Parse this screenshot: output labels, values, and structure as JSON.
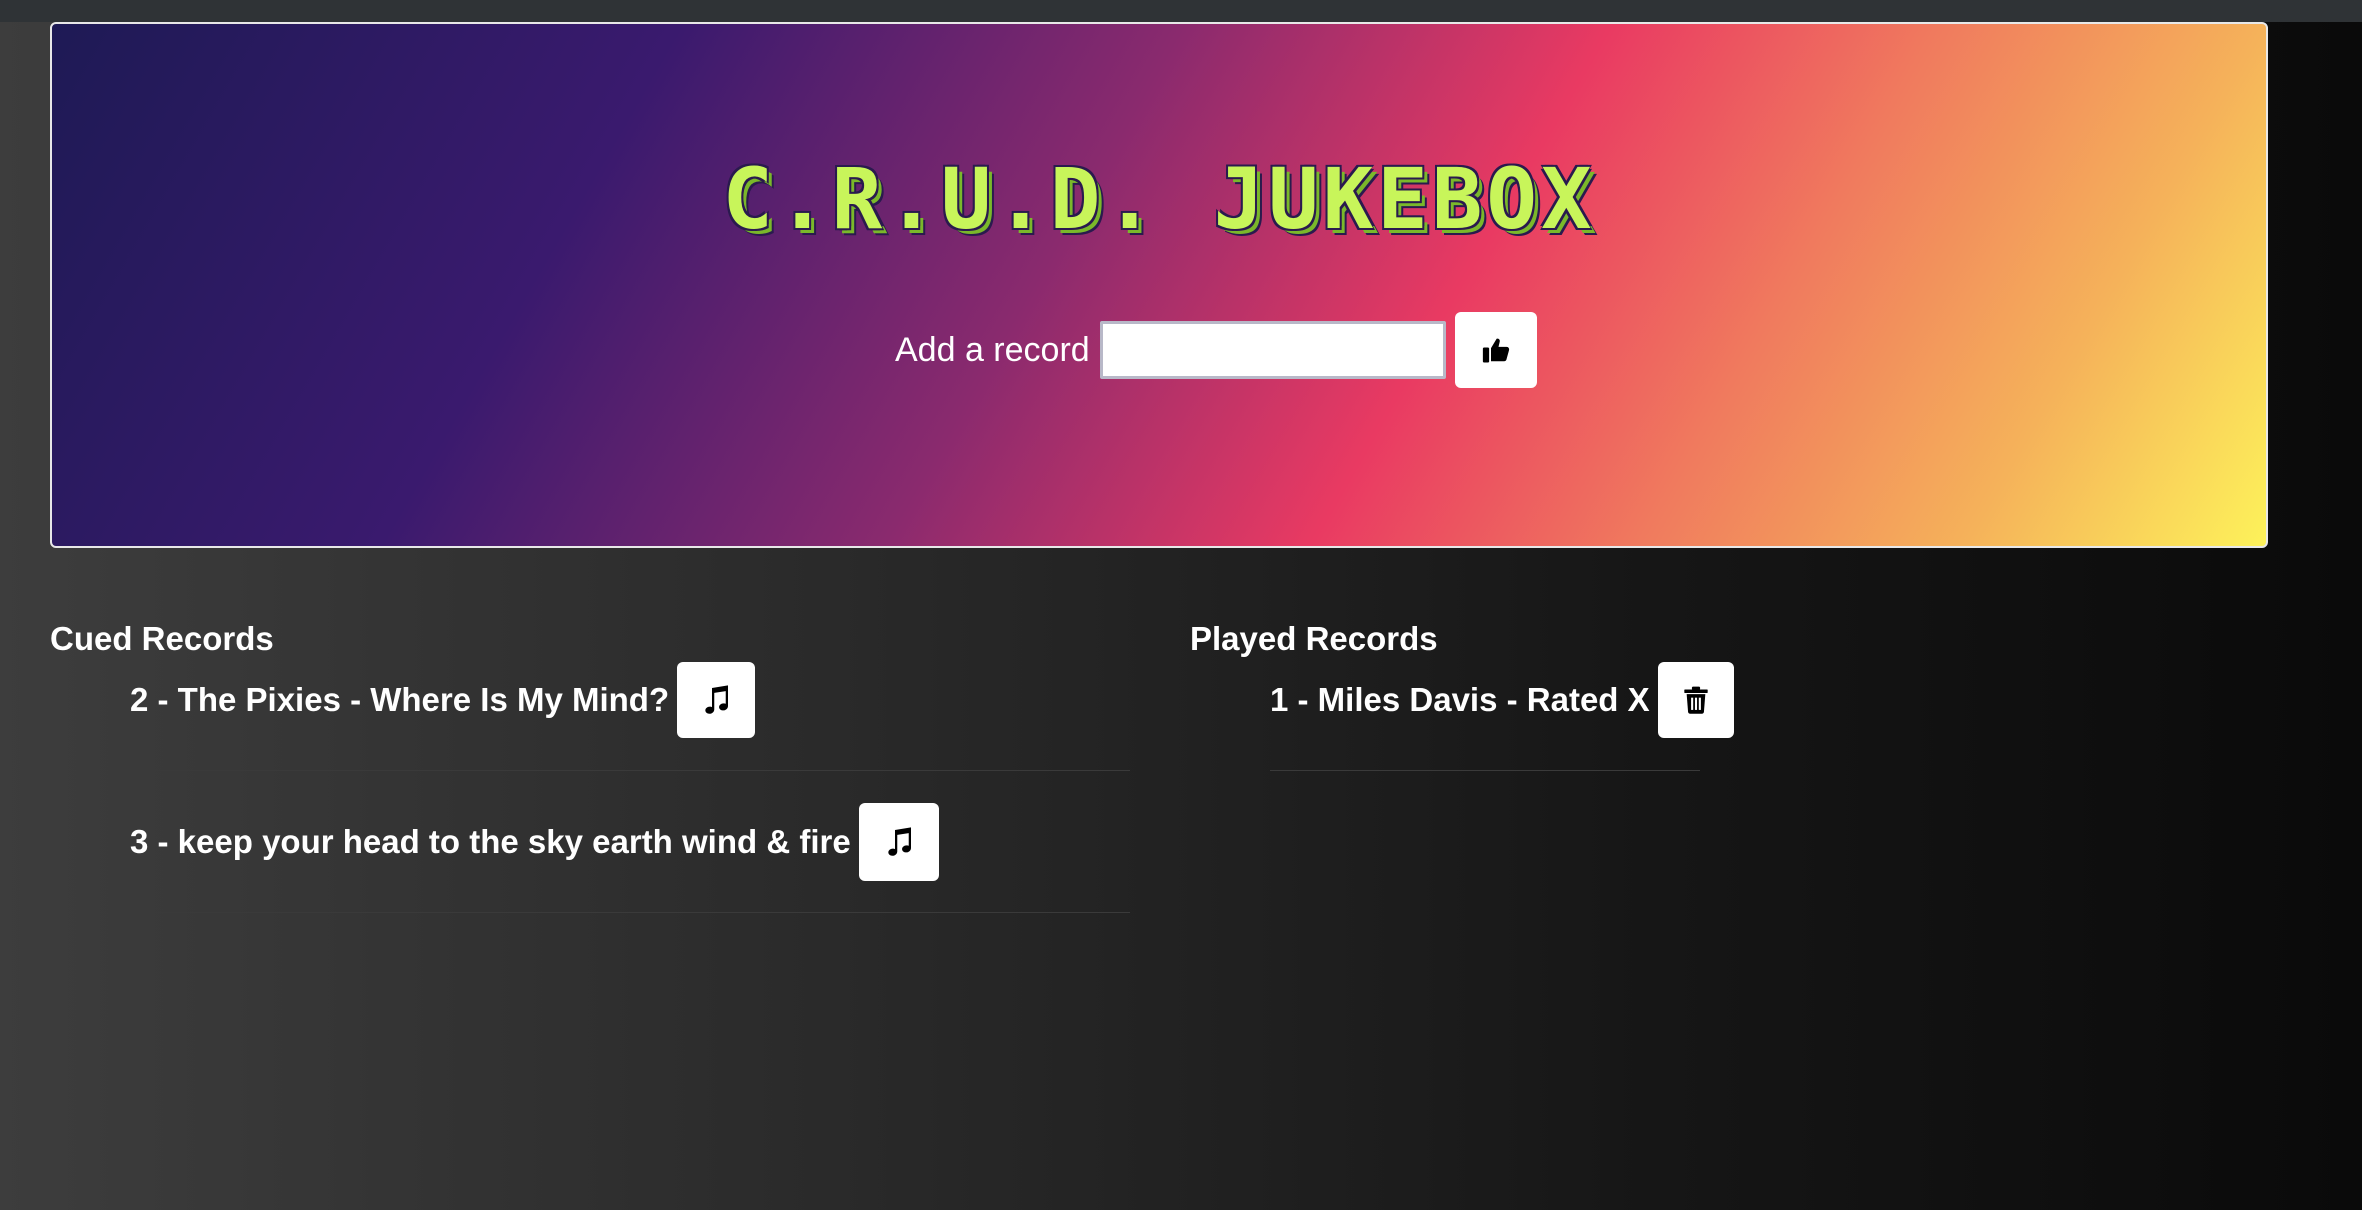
{
  "app": {
    "title": "C.R.U.D. JUKEBOX"
  },
  "add_form": {
    "label": "Add a record",
    "input_value": "",
    "input_placeholder": "",
    "submit_icon": "thumbs-up-icon"
  },
  "cued": {
    "heading": "Cued Records",
    "items": [
      {
        "label": "2 - The Pixies - Where Is My Mind?",
        "action_icon": "music-note-icon"
      },
      {
        "label": "3 - keep your head to the sky earth wind & fire",
        "action_icon": "music-note-icon"
      }
    ]
  },
  "played": {
    "heading": "Played Records",
    "items": [
      {
        "label": "1 - Miles Davis - Rated X",
        "action_icon": "trash-icon"
      }
    ]
  },
  "colors": {
    "title_fill": "#c8f55a",
    "title_outline": "#2a1a4e",
    "gradient_start": "#1e1a55",
    "gradient_mid": "#e93a62",
    "gradient_end": "#fdf25a"
  }
}
